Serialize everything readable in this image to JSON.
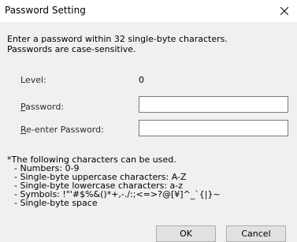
{
  "window": {
    "title": "Password Setting"
  },
  "intro": {
    "line1": "Enter a password within 32 single-byte characters.",
    "line2": "Passwords are case-sensitive."
  },
  "level": {
    "label": "Level:",
    "value": "0"
  },
  "password": {
    "label_first": "P",
    "label_rest": "assword:",
    "value": ""
  },
  "reenter": {
    "label_first": "R",
    "label_rest": "e-enter Password:",
    "value": ""
  },
  "notes": {
    "heading": "*The following characters can be used.",
    "items": [
      "- Numbers: 0-9",
      "- Single-byte uppercase characters: A-Z",
      "- Single-byte lowercase characters: a-z",
      "- Symbols: !\"'#$%&()*+,-./:;<=>?@[¥]^_`{|}~",
      "- Single-byte space"
    ]
  },
  "buttons": {
    "ok": "OK",
    "cancel": "Cancel"
  },
  "icons": {
    "close": "close-icon"
  }
}
